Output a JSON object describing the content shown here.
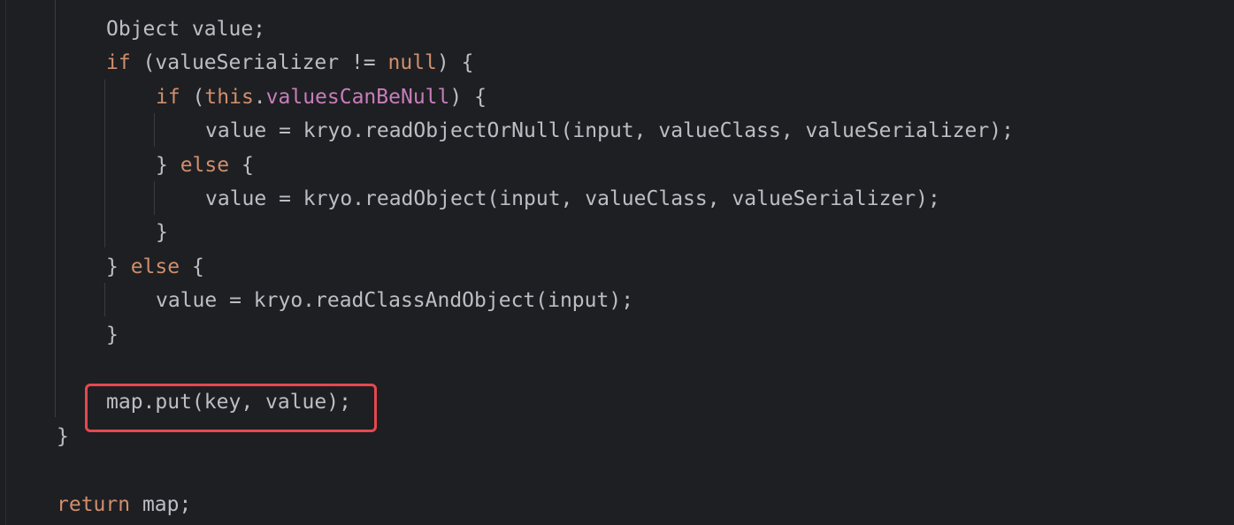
{
  "code": {
    "lines": [
      {
        "indent": 1,
        "tokens": [
          {
            "t": "Object value;",
            "k": "plain"
          }
        ]
      },
      {
        "indent": 1,
        "tokens": [
          {
            "t": "if",
            "k": "kw"
          },
          {
            "t": " (valueSerializer != ",
            "k": "plain"
          },
          {
            "t": "null",
            "k": "kw"
          },
          {
            "t": ") {",
            "k": "plain"
          }
        ]
      },
      {
        "indent": 2,
        "tokens": [
          {
            "t": "if",
            "k": "kw"
          },
          {
            "t": " (",
            "k": "plain"
          },
          {
            "t": "this",
            "k": "kw"
          },
          {
            "t": ".",
            "k": "plain"
          },
          {
            "t": "valuesCanBeNull",
            "k": "field"
          },
          {
            "t": ") {",
            "k": "plain"
          }
        ]
      },
      {
        "indent": 3,
        "tokens": [
          {
            "t": "value = kryo.readObjectOrNull(input, valueClass, valueSerializer);",
            "k": "plain"
          }
        ]
      },
      {
        "indent": 2,
        "tokens": [
          {
            "t": "} ",
            "k": "plain"
          },
          {
            "t": "else",
            "k": "kw"
          },
          {
            "t": " {",
            "k": "plain"
          }
        ]
      },
      {
        "indent": 3,
        "tokens": [
          {
            "t": "value = kryo.readObject(input, valueClass, valueSerializer);",
            "k": "plain"
          }
        ]
      },
      {
        "indent": 2,
        "tokens": [
          {
            "t": "}",
            "k": "plain"
          }
        ]
      },
      {
        "indent": 1,
        "tokens": [
          {
            "t": "} ",
            "k": "plain"
          },
          {
            "t": "else",
            "k": "kw"
          },
          {
            "t": " {",
            "k": "plain"
          }
        ]
      },
      {
        "indent": 2,
        "tokens": [
          {
            "t": "value = kryo.readClassAndObject(input);",
            "k": "plain"
          }
        ]
      },
      {
        "indent": 1,
        "tokens": [
          {
            "t": "}",
            "k": "plain"
          }
        ]
      },
      {
        "indent": 0,
        "tokens": []
      },
      {
        "indent": 1,
        "tokens": [
          {
            "t": "map.put(key, value);",
            "k": "plain"
          }
        ],
        "highlighted": true
      },
      {
        "indent": 0,
        "tokens": [
          {
            "t": "}",
            "k": "plain"
          }
        ]
      },
      {
        "indent": 0,
        "tokens": []
      },
      {
        "indent": 0,
        "tokens": [
          {
            "t": "return",
            "k": "kw"
          },
          {
            "t": " map;",
            "k": "plain"
          }
        ]
      }
    ]
  },
  "colors": {
    "background": "#1e1f22",
    "plain_text": "#bcbec4",
    "keyword": "#cf8e6d",
    "field": "#c77dbb",
    "highlight_border": "#e5484f"
  }
}
